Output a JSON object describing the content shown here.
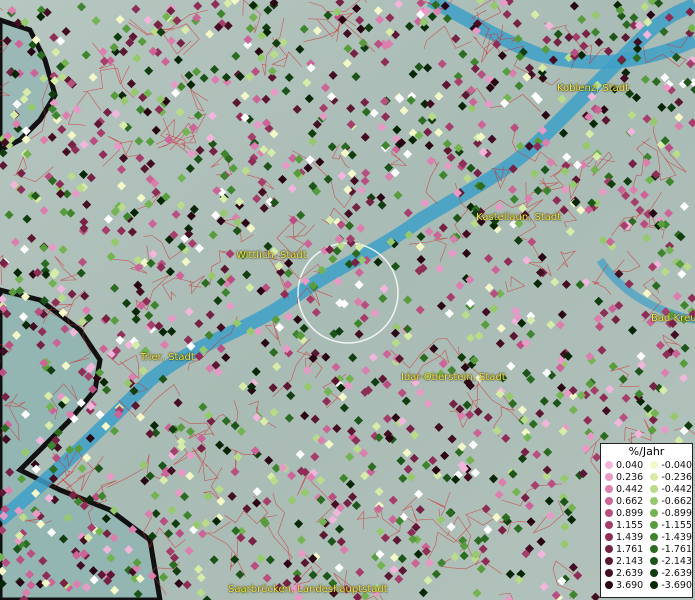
{
  "map": {
    "colors": {
      "land": "#a9bcb6",
      "water": "#3ea0c8",
      "outside": "#8fb4b0",
      "borders": "#d02a2a",
      "label": "#f3e24a"
    },
    "cities": [
      {
        "name": "Koblenz, Stadt"
      },
      {
        "name": "Kastellaun, Stadt"
      },
      {
        "name": "Wittlich, Stadt"
      },
      {
        "name": "Bad Kreu"
      },
      {
        "name": "Trier, Stadt"
      },
      {
        "name": "Idar-Oberstein, Stadt"
      },
      {
        "name": "Saarbrücken, Landeshauptstadt"
      }
    ]
  },
  "legend": {
    "title": "%/Jahr",
    "positive": [
      {
        "label": "0.040",
        "color": "#f2b6dc"
      },
      {
        "label": "0.236",
        "color": "#e89ac6"
      },
      {
        "label": "0.442",
        "color": "#db7fae"
      },
      {
        "label": "0.662",
        "color": "#cc6497"
      },
      {
        "label": "0.899",
        "color": "#b94f80"
      },
      {
        "label": "1.155",
        "color": "#a63e6c"
      },
      {
        "label": "1.439",
        "color": "#8e2e57"
      },
      {
        "label": "1.761",
        "color": "#762244"
      },
      {
        "label": "2.143",
        "color": "#5c1733"
      },
      {
        "label": "2.639",
        "color": "#430e23"
      },
      {
        "label": "3.690",
        "color": "#2a0614"
      }
    ],
    "negative": [
      {
        "label": "-0.040",
        "color": "#f4f8c8"
      },
      {
        "label": "-0.236",
        "color": "#d8ecaa"
      },
      {
        "label": "-0.442",
        "color": "#b8dc8a"
      },
      {
        "label": "-0.662",
        "color": "#96c96c"
      },
      {
        "label": "-0.899",
        "color": "#74b352"
      },
      {
        "label": "-1.155",
        "color": "#589c3e"
      },
      {
        "label": "-1.439",
        "color": "#3f842e"
      },
      {
        "label": "-1.761",
        "color": "#2c6c22"
      },
      {
        "label": "-2.143",
        "color": "#1d5419"
      },
      {
        "label": "-2.639",
        "color": "#113d10"
      },
      {
        "label": "-3.690",
        "color": "#072606"
      }
    ]
  }
}
